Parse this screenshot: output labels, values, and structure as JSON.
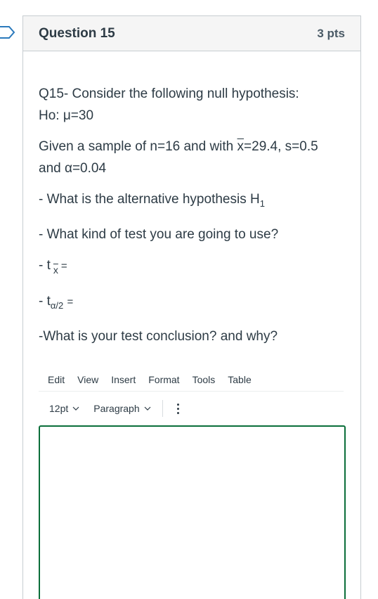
{
  "question": {
    "title": "Question 15",
    "points": "3 pts"
  },
  "body": {
    "line1": "Q15- Consider the following null hypothesis:",
    "line2": "Ho: μ=30",
    "given_a": "Given a sample of n=16 and with ",
    "xbar": "x",
    "given_b": "=29.4, s=0.5",
    "given_c": "and α=0.04",
    "alt_a": "- What is the alternative hypothesis H",
    "alt_sub": "1",
    "kind": "- What kind of test you are going to use?",
    "t_prefix": "- t",
    "t_sub": "x",
    "t_eq": "=",
    "ta_prefix": "- t",
    "ta_sub": "α/2",
    "ta_eq": "=",
    "conclusion": "-What is your test conclusion? and why?"
  },
  "editor": {
    "menu": [
      "Edit",
      "View",
      "Insert",
      "Format",
      "Tools",
      "Table"
    ],
    "font_size": "12pt",
    "block_format": "Paragraph"
  },
  "colors": {
    "focus_border": "#0b6e3a",
    "flag": "#2b7abc"
  }
}
